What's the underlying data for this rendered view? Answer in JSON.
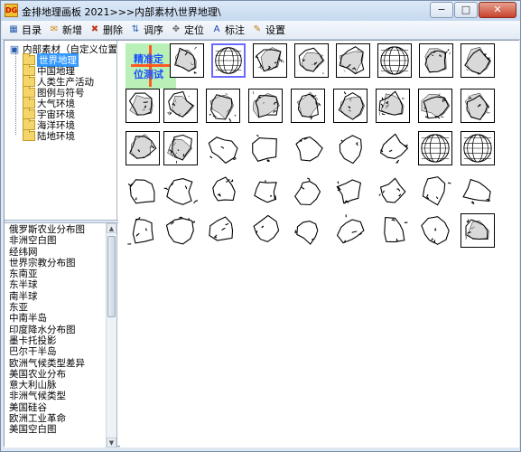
{
  "window": {
    "title": "金排地理画板 2021>>>内部素材\\世界地理\\",
    "app_icon_text": "DG",
    "minimize_symbol": "−",
    "maximize_symbol": "□",
    "close_symbol": "✕"
  },
  "toolbar": [
    {
      "label": "目录",
      "icon": "catalog-icon",
      "glyph": "▦",
      "color": "#2a5db0"
    },
    {
      "label": "新增",
      "icon": "add-icon",
      "glyph": "✉",
      "color": "#d08a1a"
    },
    {
      "label": "删除",
      "icon": "delete-icon",
      "glyph": "✖",
      "color": "#c03a20"
    },
    {
      "label": "调序",
      "icon": "reorder-icon",
      "glyph": "⇅",
      "color": "#2a5db0"
    },
    {
      "label": "定位",
      "icon": "locate-icon",
      "glyph": "✥",
      "color": "#666"
    },
    {
      "label": "标注",
      "icon": "annotate-icon",
      "glyph": "A",
      "color": "#1a3fb0"
    },
    {
      "label": "设置",
      "icon": "settings-icon",
      "glyph": "✎",
      "color": "#c07a10"
    }
  ],
  "tree": {
    "root_label": "内部素材（自定义位置）",
    "items": [
      {
        "label": "世界地理",
        "selected": true
      },
      {
        "label": "中国地理",
        "selected": false
      },
      {
        "label": "人类生产活动",
        "selected": false
      },
      {
        "label": "图例与符号",
        "selected": false
      },
      {
        "label": "大气环境",
        "selected": false
      },
      {
        "label": "宇宙环境",
        "selected": false
      },
      {
        "label": "海洋环境",
        "selected": false
      },
      {
        "label": "陆地环境",
        "selected": false
      }
    ]
  },
  "file_list": [
    "俄罗斯农业分布图",
    "非洲空白图",
    "经纬网",
    "世界宗教分布图",
    "东南亚",
    "东半球",
    "南半球",
    "东亚",
    "中南半岛",
    "印度降水分布图",
    "墨卡托投影",
    "巴尔干半岛",
    "欧洲气候类型差异",
    "美国农业分布",
    "意大利山脉",
    "非洲气候类型",
    "美国硅谷",
    "欧洲工业革命",
    "美国空白图"
  ],
  "first_tile": {
    "line1": "精准定",
    "line2": "位测试"
  },
  "scrollbar": {
    "up": "▲",
    "down": "▼"
  }
}
